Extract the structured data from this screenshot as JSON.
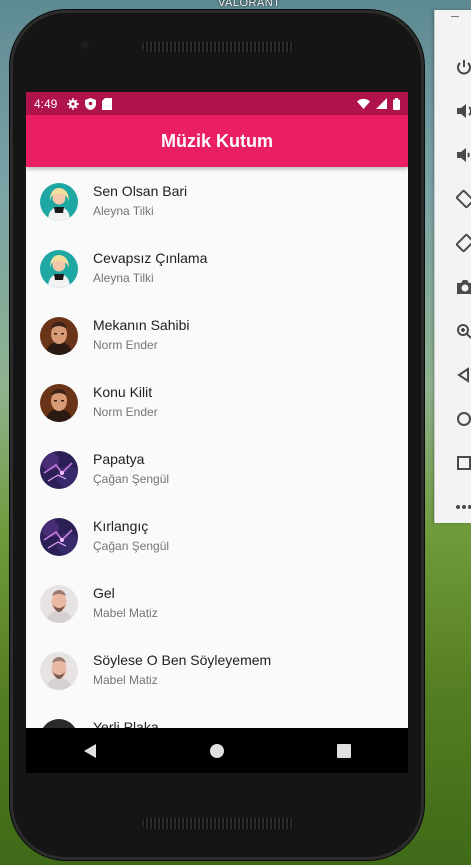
{
  "desktop": {
    "label": "VALORANT"
  },
  "status_bar": {
    "time": "4:49",
    "icons": [
      "settings-icon",
      "shield-icon",
      "sd-card-icon",
      "wifi-icon",
      "signal-icon",
      "battery-icon"
    ],
    "color": "#b0124b"
  },
  "app_bar": {
    "title": "Müzik Kutum",
    "color": "#e91e63"
  },
  "songs": [
    {
      "title": "Sen Olsan Bari",
      "artist": "Aleyna Tilki",
      "avatar": "aleyna"
    },
    {
      "title": "Cevapsız Çınlama",
      "artist": "Aleyna Tilki",
      "avatar": "aleyna"
    },
    {
      "title": "Mekanın Sahibi",
      "artist": "Norm Ender",
      "avatar": "norm"
    },
    {
      "title": "Konu Kilit",
      "artist": "Norm Ender",
      "avatar": "norm"
    },
    {
      "title": "Papatya",
      "artist": "Çağan Şengül",
      "avatar": "cagan"
    },
    {
      "title": "Kırlangıç",
      "artist": "Çağan Şengül",
      "avatar": "cagan"
    },
    {
      "title": "Gel",
      "artist": "Mabel Matiz",
      "avatar": "mabel"
    },
    {
      "title": "Söylese O Ben Söyleyemem",
      "artist": "Mabel Matiz",
      "avatar": "mabel"
    },
    {
      "title": "Yerli Plaka",
      "artist": "",
      "avatar": "dark"
    }
  ],
  "nav_bar": {
    "icons": [
      "back-icon",
      "home-icon",
      "recents-icon"
    ]
  },
  "emulator_toolbar": {
    "icons": [
      "power-icon",
      "volume-up-icon",
      "volume-down-icon",
      "rotate-left-icon",
      "rotate-right-icon",
      "camera-icon",
      "zoom-icon",
      "back-icon",
      "home-icon",
      "overview-icon",
      "more-icon"
    ]
  }
}
